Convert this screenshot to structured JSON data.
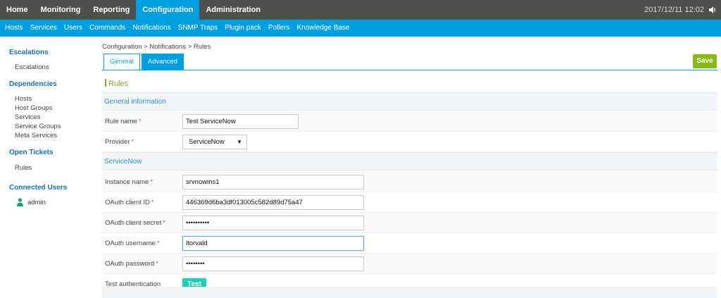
{
  "topnav": {
    "items": [
      {
        "label": "Home"
      },
      {
        "label": "Monitoring"
      },
      {
        "label": "Reporting"
      },
      {
        "label": "Configuration"
      },
      {
        "label": "Administration"
      }
    ],
    "active": "Configuration",
    "clock": "2017/12/11 12:02",
    "sound_icon": "speaker-icon"
  },
  "subnav": {
    "items": [
      {
        "label": "Hosts"
      },
      {
        "label": "Services"
      },
      {
        "label": "Users"
      },
      {
        "label": "Commands"
      },
      {
        "label": "Notifications"
      },
      {
        "label": "SNMP Traps"
      },
      {
        "label": "Plugin pack"
      },
      {
        "label": "Pollers"
      },
      {
        "label": "Knowledge Base"
      }
    ]
  },
  "sidebar": {
    "escalations_title": "Escalations",
    "escalations_link": "Escalations",
    "dependencies_title": "Dependencies",
    "dependencies_links": [
      "Hosts",
      "Host Groups",
      "Services",
      "Service Groups",
      "Meta Services"
    ],
    "open_tickets_title": "Open Tickets",
    "open_tickets_link": "Rules",
    "connected_users_title": "Connected Users",
    "user_name": "admin",
    "user_icon": "user-icon"
  },
  "main": {
    "breadcrumb": "Configuration  >  Notifications  >  Rules",
    "tabs": [
      {
        "label": "General"
      },
      {
        "label": "Advanced"
      }
    ],
    "save_label": "Save",
    "page_title": "Rules",
    "general_section": "General information",
    "rule_name_label": "Rule name",
    "rule_name_value": "Test ServiceNow",
    "provider_label": "Provider",
    "provider_value": "ServiceNow",
    "servicenow_section": "ServiceNow",
    "instance_name_label": "Instance name",
    "instance_name_value": "srvnowins1",
    "client_id_label": "OAuth client ID",
    "client_id_value": "446369d6ba3df013005c582d89d75a47",
    "client_secret_label": "OAuth client secret",
    "client_secret_value": "••••••••••",
    "username_label": "OAuth username",
    "username_value": "ltorvald",
    "password_label": "OAuth password",
    "password_value": "••••••••",
    "test_auth_label": "Test authentication",
    "test_button": "Test",
    "required_marker": "*"
  },
  "colors": {
    "topbar": "#4f4f4f",
    "accent": "#009fdf",
    "save": "#88b917",
    "test": "#1ccfb4",
    "title": "#8aa32f"
  }
}
